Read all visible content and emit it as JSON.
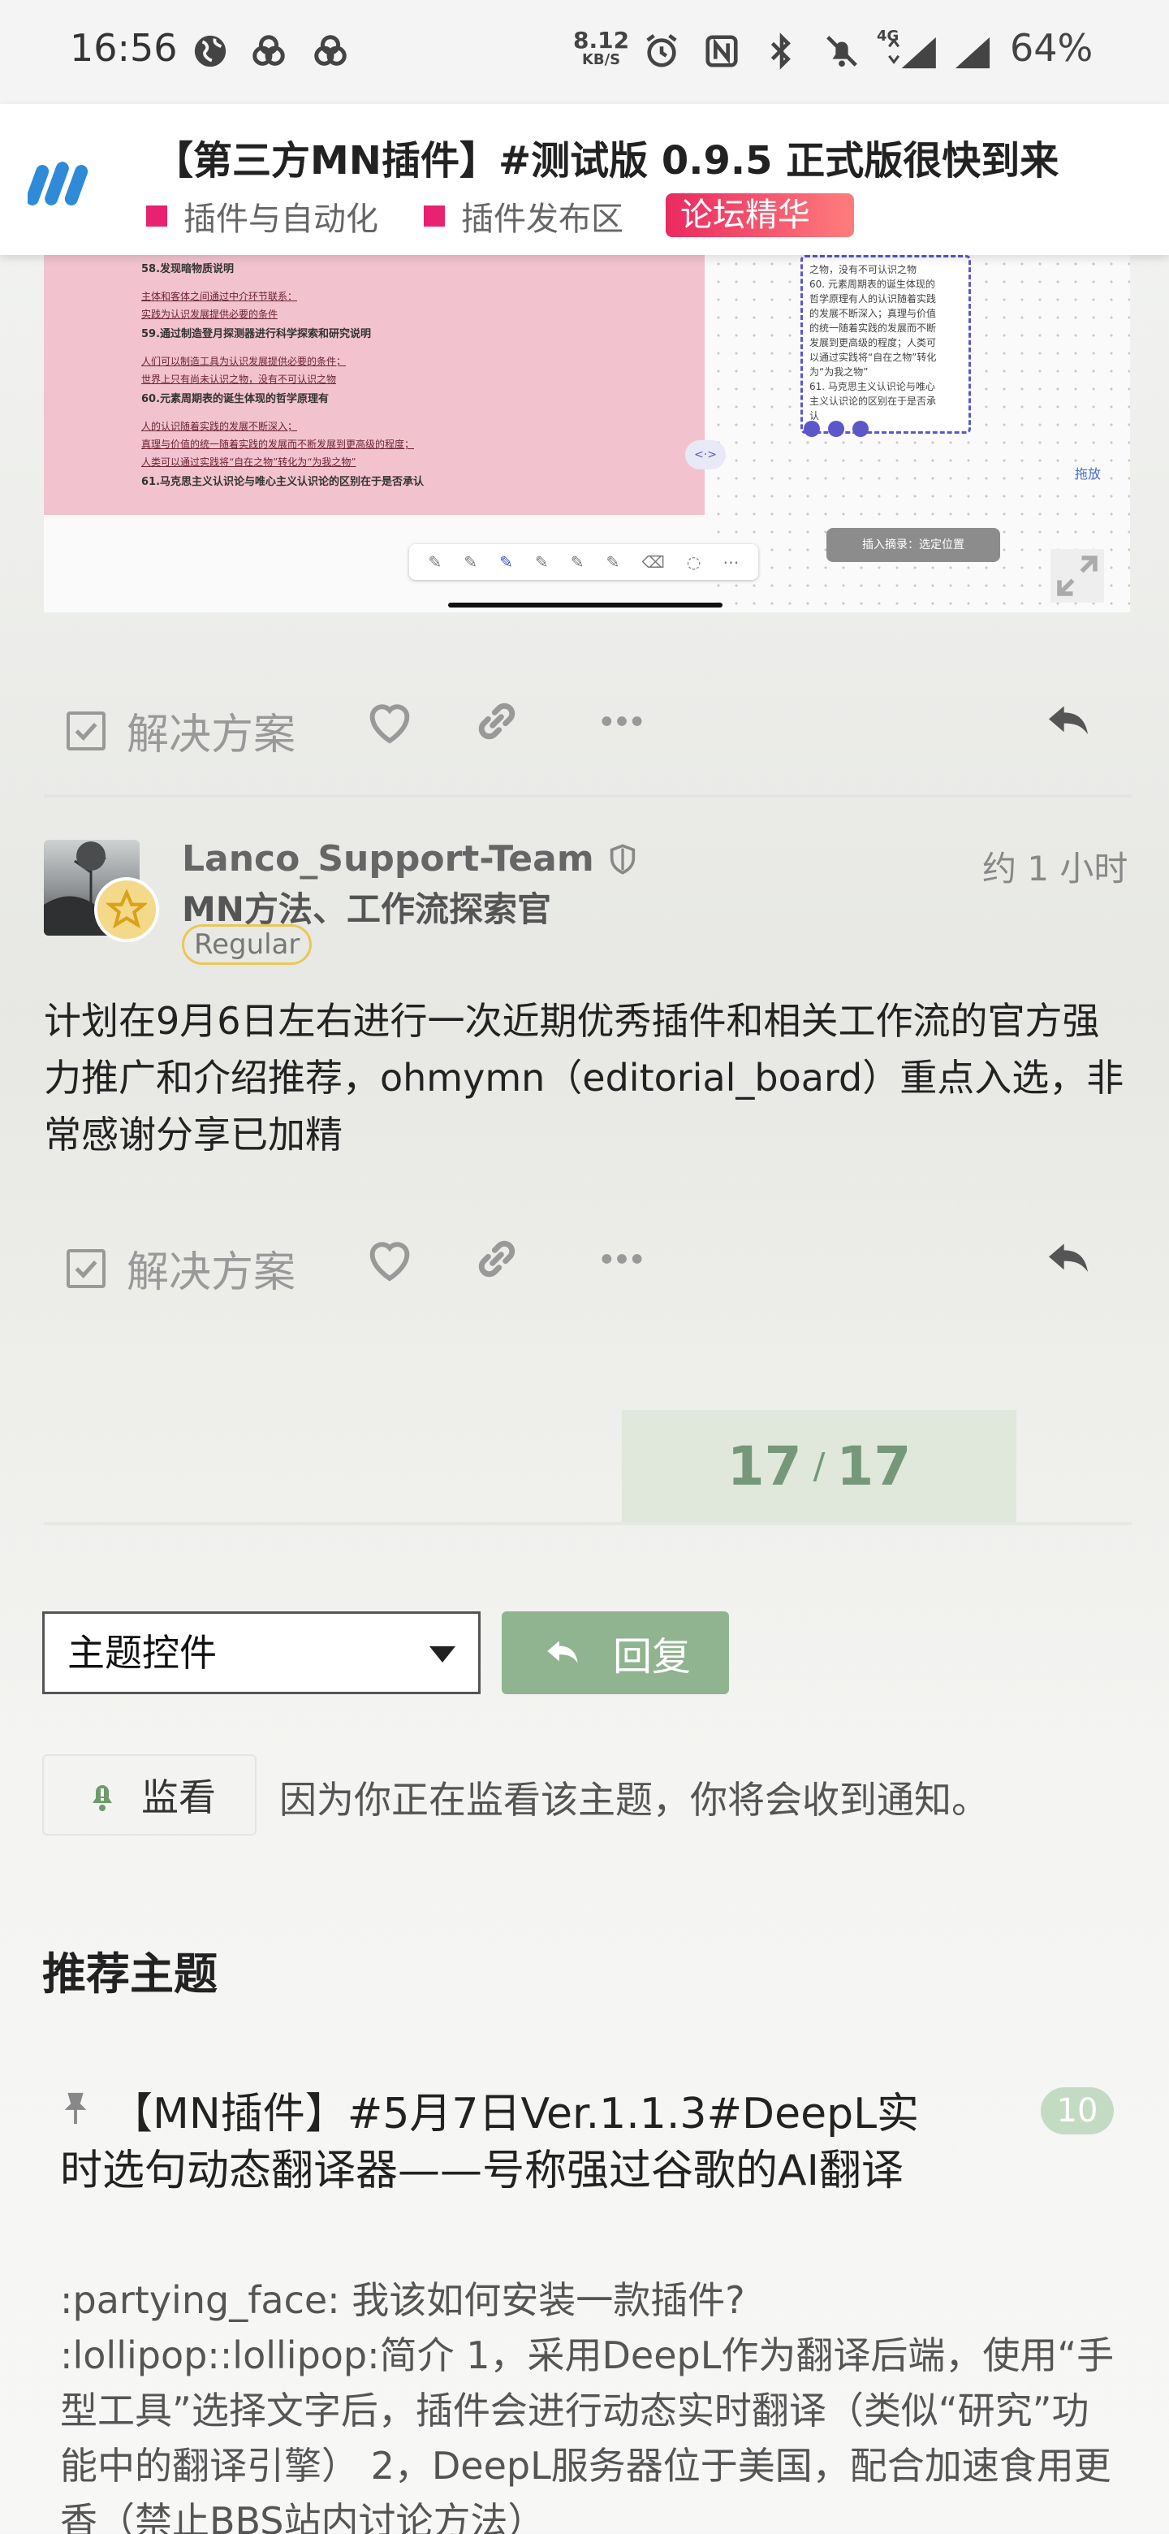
{
  "status_bar": {
    "time": "16:56",
    "net_speed_value": "8.12",
    "net_speed_unit": "KB/S",
    "network_type": "4G",
    "battery": "64%"
  },
  "header": {
    "logo_icon": "discourse-m-logo",
    "title": "【第三方MN插件】#测试版 0.9.5 正式版很快到来",
    "category_1": "插件与自动化",
    "category_2": "插件发布区",
    "featured_tag": "论坛精华",
    "tag_color": "#e8226f"
  },
  "preview": {
    "lines": [
      {
        "text": "58.发现暗物质说明",
        "bold": true
      },
      {
        "text": "主体和客体之间通过中介环节联系：",
        "bold": false
      },
      {
        "text": "实践为认识发展提供必要的条件",
        "bold": false
      },
      {
        "text": "59.通过制造登月探测器进行科学探索和研究说明",
        "bold": true
      },
      {
        "text": "人们可以制造工具为认识发展提供必要的条件；",
        "bold": false
      },
      {
        "text": "世界上只有尚未认识之物，没有不可认识之物",
        "bold": false
      },
      {
        "text": "60.元素周期表的诞生体现的哲学原理有",
        "bold": true
      },
      {
        "text": "人的认识随着实践的发展不断深入；",
        "bold": false
      },
      {
        "text": "真理与价值的统一随着实践的发展而不断发展到更高级的程度；",
        "bold": false
      },
      {
        "text": "人类可以通过实践将“自在之物”转化为“为我之物”",
        "bold": false
      },
      {
        "text": "61.马克思主义认识论与唯心主义认识论的区别在于是否承认",
        "bold": true
      }
    ],
    "card_lines": [
      "之物，没有不可认识之物",
      "60. 元素周期表的诞生体现的",
      "哲学原理有人的认识随着实践",
      "的发展不断深入；真理与价值",
      "的统一随着实践的发展而不断",
      "发展到更高级的程度；人类可",
      "以通过实践将“自在之物”转化",
      "为“为我之物”",
      "61. 马克思主义认识论与唯心",
      "主义认识论的区别在于是否承",
      "认"
    ],
    "drag_label": "拖放",
    "insert_label": "插入摘录：选定位置",
    "expand_icon": "expand-icon"
  },
  "actions": {
    "solution_label": "解决方案",
    "like_icon": "heart-icon",
    "link_icon": "link-icon",
    "more_icon": "ellipsis-icon",
    "reply_icon": "reply-arrow-icon"
  },
  "post": {
    "username": "Lanco_Support-Team",
    "user_title": "MN方法、工作流探索官",
    "trust_level": "Regular",
    "time_ago": "约 1 小时",
    "body": "计划在9月6日左右进行一次近期优秀插件和相关工作流的官方强力推广和介绍推荐，ohmymn（editorial_board）重点入选，非常感谢分享已加精"
  },
  "progress": {
    "current": "17",
    "separator": "/",
    "total": "17"
  },
  "controls": {
    "topic_controls_label": "主题控件",
    "reply_label": "回复",
    "watch_label": "监看",
    "watch_notice": "因为你正在监看该主题，你将会收到通知。"
  },
  "recommended": {
    "heading": "推荐主题",
    "topic_title": "【MN插件】#5月7日Ver.1.1.3#DeepL实时选句动态翻译器——号称强过谷歌的AI翻译",
    "reply_count": "10",
    "excerpt_1": ":partying_face: 我该如何安装一款插件?",
    "excerpt_2": ":lollipop::lollipop:简介 1，采用DeepL作为翻译后端，使用“手型工具”选择文字后，插件会进行动态实时翻译（类似“研究”功能中的翻译引擎） 2，DeepL服务器位于美国，配合加速食用更香（禁止BBS站内讨论方法）"
  }
}
